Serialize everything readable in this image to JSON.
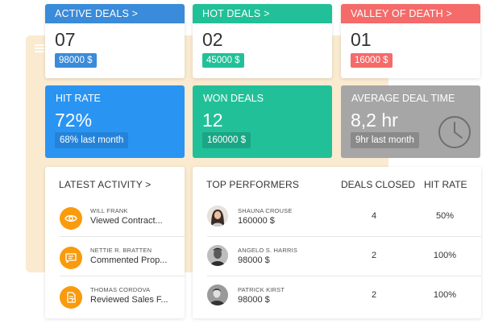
{
  "colors": {
    "blue": "#3a8bd9",
    "teal": "#22c098",
    "red": "#f46b6a",
    "bright_blue": "#2a94f2",
    "grey": "#a6a6a6",
    "orange": "#f99b0d",
    "beige": "#f9ead0"
  },
  "top_cards": [
    {
      "title": "ACTIVE DEALS >",
      "count": "07",
      "amount": "98000 $"
    },
    {
      "title": "HOT DEALS >",
      "count": "02",
      "amount": "45000 $"
    },
    {
      "title": "VALLEY OF DEATH >",
      "count": "01",
      "amount": "16000 $"
    }
  ],
  "stats": [
    {
      "title": "HIT RATE",
      "value": "72%",
      "note": "68% last month"
    },
    {
      "title": "WON DEALS",
      "value": "12",
      "note": "160000 $"
    },
    {
      "title": "AVERAGE DEAL TIME",
      "value": "8,2 hr",
      "note": "9hr last month",
      "icon": "clock-icon"
    }
  ],
  "activity": {
    "title": "LATEST ACTIVITY >",
    "items": [
      {
        "name": "WILL FRANK",
        "text": "Viewed Contract...",
        "icon": "eye-icon"
      },
      {
        "name": "NETTIE R. BRATTEN",
        "text": "Commented Prop...",
        "icon": "comment-icon"
      },
      {
        "name": "THOMAS CORDOVA",
        "text": "Reviewed Sales F...",
        "icon": "document-icon"
      }
    ]
  },
  "performers": {
    "title": "TOP PERFORMERS",
    "col_closed": "DEALS CLOSED",
    "col_rate": "HIT RATE",
    "rows": [
      {
        "name": "SHAUNA CROUSE",
        "amount": "160000 $",
        "closed": "4",
        "rate": "50%"
      },
      {
        "name": "ANGELO S. HARRIS",
        "amount": "98000 $",
        "closed": "2",
        "rate": "100%"
      },
      {
        "name": "PATRICK KIRST",
        "amount": "98000 $",
        "closed": "2",
        "rate": "100%"
      }
    ]
  }
}
